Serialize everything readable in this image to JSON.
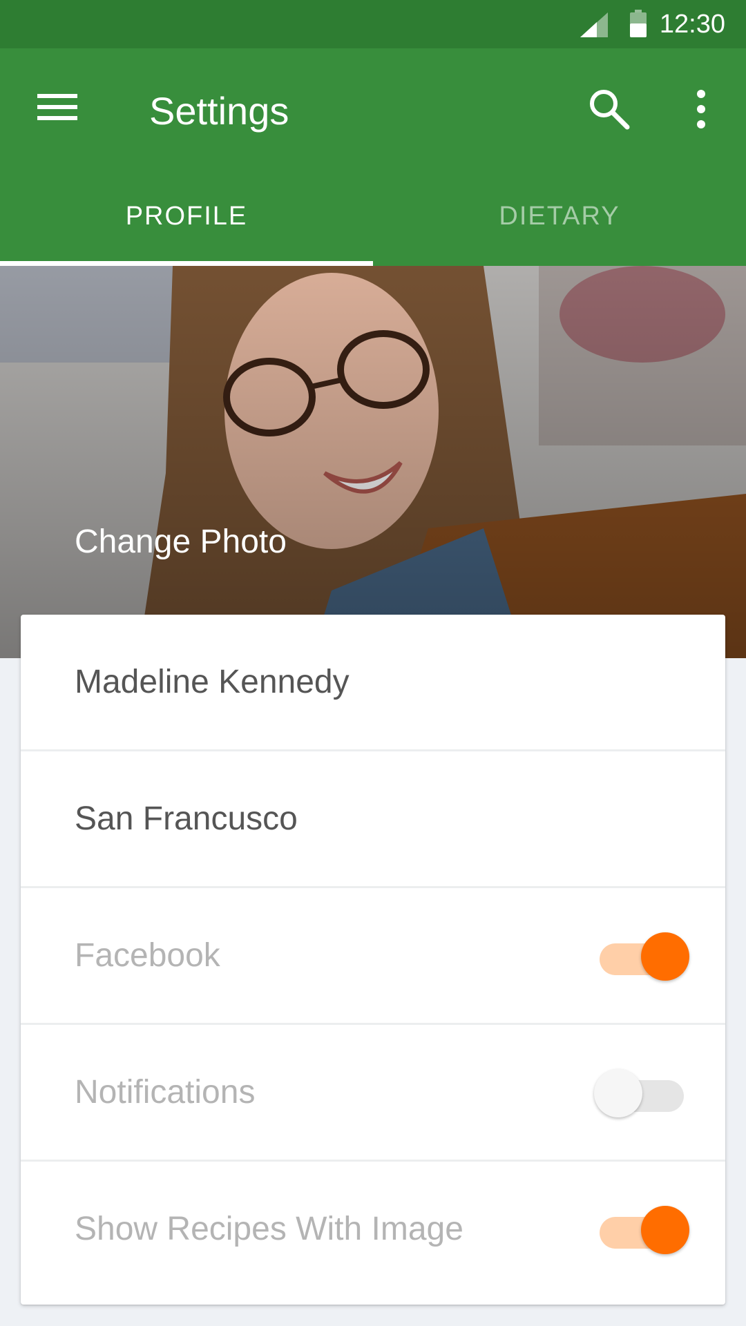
{
  "status_bar": {
    "time": "12:30"
  },
  "app_bar": {
    "title": "Settings"
  },
  "tabs": [
    {
      "label": "PROFILE",
      "active": true
    },
    {
      "label": "DIETARY",
      "active": false
    }
  ],
  "profile": {
    "change_photo_label": "Change Photo",
    "name": "Madeline Kennedy",
    "location": "San Francusco"
  },
  "settings": [
    {
      "label": "Facebook",
      "enabled": true
    },
    {
      "label": "Notifications",
      "enabled": false
    },
    {
      "label": "Show Recipes With Image",
      "enabled": true
    }
  ],
  "colors": {
    "status_bar": "#2e7d32",
    "app_bar": "#388e3c",
    "toggle_on": "#ff6d00",
    "toggle_on_track": "#ffcfa8"
  },
  "icons": [
    "menu-icon",
    "search-icon",
    "more-vert-icon",
    "signal-icon",
    "battery-icon"
  ]
}
